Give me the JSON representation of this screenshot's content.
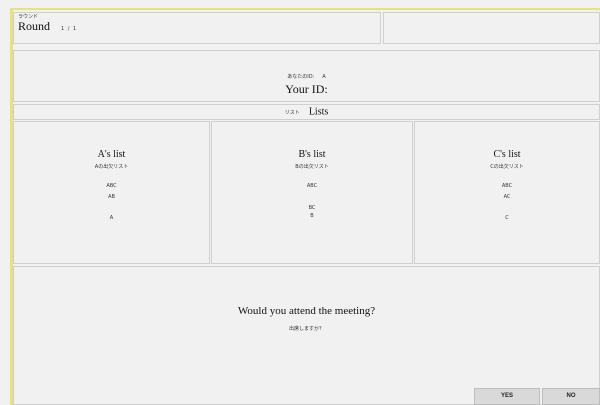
{
  "round": {
    "label_jp": "ラウンド",
    "label_en": "Round",
    "count": "1 / 1"
  },
  "identity": {
    "label_jp": "あなたのID:",
    "value": "A",
    "label_en": "Your ID:"
  },
  "lists": {
    "label_jp": "リスト",
    "label_en": "Lists",
    "columns": [
      {
        "title": "A's list",
        "subtitle": "Aの出欠リスト",
        "entries": [
          "ABC",
          "AB",
          "",
          "A"
        ]
      },
      {
        "title": "B's list",
        "subtitle": "Bの出欠リスト",
        "entries": [
          "ABC",
          "",
          "BC",
          "B"
        ]
      },
      {
        "title": "C's list",
        "subtitle": "Cの出欠リスト",
        "entries": [
          "ABC",
          "AC",
          "",
          "C"
        ]
      }
    ]
  },
  "question": {
    "text_en": "Would you attend the meeting?",
    "text_jp": "出席しますか？"
  },
  "buttons": {
    "yes": "YES",
    "no": "NO"
  }
}
